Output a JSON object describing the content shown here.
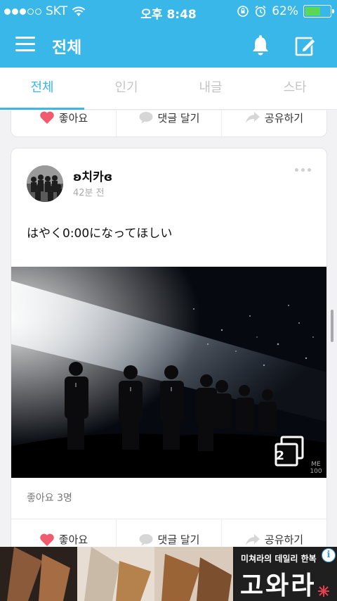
{
  "status_bar": {
    "carrier": "SKT",
    "time": "오후 8:48",
    "battery": "62%",
    "battery_level": 0.62
  },
  "header": {
    "title": "전체"
  },
  "tabs": [
    {
      "label": "전체",
      "active": true
    },
    {
      "label": "인기",
      "active": false
    },
    {
      "label": "내글",
      "active": false
    },
    {
      "label": "스타",
      "active": false
    }
  ],
  "actions": {
    "like": "좋아요",
    "comment": "댓글 달기",
    "share": "공유하기"
  },
  "post": {
    "username": "ʚ치카ɞ",
    "time": "42분 전",
    "text": "はやく0:00になってほしい",
    "photo_count": "2",
    "photo_watermark": "ME 100",
    "likes": "좋아요 3명"
  },
  "ad": {
    "subtitle": "미쳐라의 데일리 한복",
    "title": "고와라",
    "info": "i"
  },
  "colors": {
    "accent": "#39b7e8",
    "heart": "#f05c6e"
  }
}
